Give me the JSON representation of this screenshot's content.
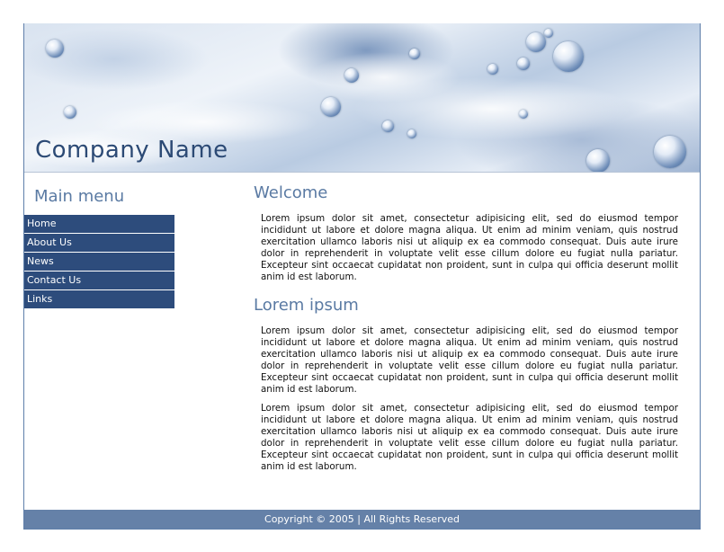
{
  "header": {
    "company_name": "Company Name"
  },
  "sidebar": {
    "title": "Main menu",
    "items": [
      {
        "label": "Home"
      },
      {
        "label": "About Us"
      },
      {
        "label": "News"
      },
      {
        "label": "Contact Us"
      },
      {
        "label": "Links"
      }
    ]
  },
  "main": {
    "sections": [
      {
        "title": "Welcome",
        "paragraphs": [
          "Lorem ipsum dolor sit amet, consectetur adipisicing elit, sed do eiusmod tempor incididunt ut labore et dolore magna aliqua. Ut enim ad minim veniam, quis nostrud exercitation ullamco laboris nisi ut aliquip ex ea commodo consequat. Duis aute irure dolor in reprehenderit in voluptate velit esse cillum dolore eu fugiat nulla pariatur. Excepteur sint occaecat cupidatat non proident, sunt in culpa qui officia deserunt mollit anim id est laborum."
        ]
      },
      {
        "title": "Lorem ipsum",
        "paragraphs": [
          "Lorem ipsum dolor sit amet, consectetur adipisicing elit, sed do eiusmod tempor incididunt ut labore et dolore magna aliqua. Ut enim ad minim veniam, quis nostrud exercitation ullamco laboris nisi ut aliquip ex ea commodo consequat. Duis aute irure dolor in reprehenderit in voluptate velit esse cillum dolore eu fugiat nulla pariatur. Excepteur sint occaecat cupidatat non proident, sunt in culpa qui officia deserunt mollit anim id est laborum.",
          "Lorem ipsum dolor sit amet, consectetur adipisicing elit, sed do eiusmod tempor incididunt ut labore et dolore magna aliqua. Ut enim ad minim veniam, quis nostrud exercitation ullamco laboris nisi ut aliquip ex ea commodo consequat. Duis aute irure dolor in reprehenderit in voluptate velit esse cillum dolore eu fugiat nulla pariatur. Excepteur sint occaecat cupidatat non proident, sunt in culpa qui officia deserunt mollit anim id est laborum."
        ]
      }
    ]
  },
  "footer": {
    "copyright": "Copyright © 2005 | All Rights Reserved"
  },
  "colors": {
    "menu_bg": "#2d4c7c",
    "heading": "#5a7aa3",
    "company_name": "#2c4a75",
    "footer_bg": "#6581a8"
  }
}
